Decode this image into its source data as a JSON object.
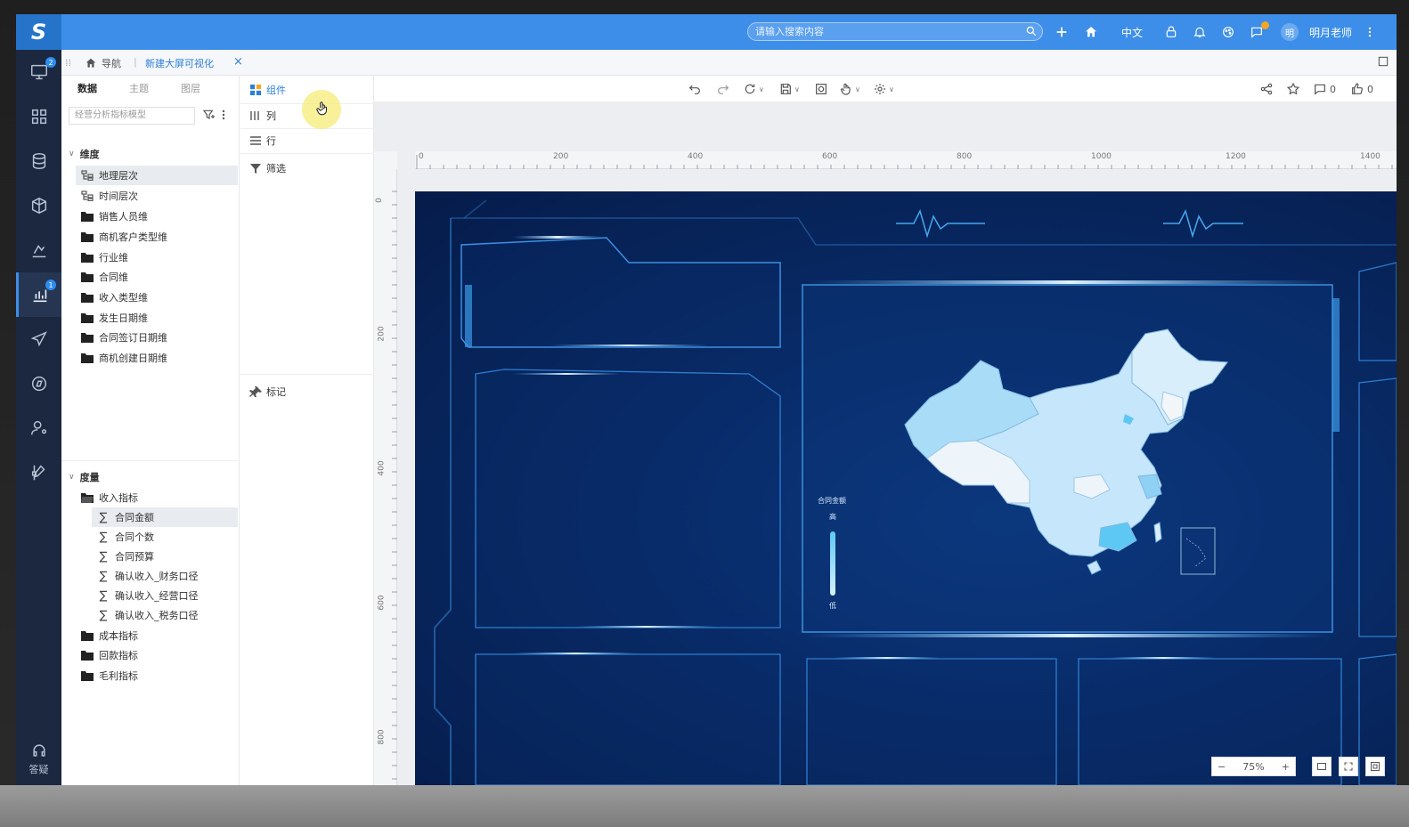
{
  "topbar": {
    "search_placeholder": "请输入搜索内容",
    "language": "中文",
    "avatar_text": "明",
    "user_name": "明月老师"
  },
  "rail": {
    "badges": [
      "2",
      "1"
    ],
    "help_label": "答疑"
  },
  "tabbar": {
    "home_label": "导航",
    "separator": "|",
    "active_tab": "新建大屏可视化",
    "close_symbol": "×"
  },
  "datapanel": {
    "tabs": [
      "数据",
      "主题",
      "图层"
    ],
    "model_select_value": "经营分析指标模型",
    "dimension_section": "维度",
    "dimensions": [
      "地理层次",
      "时间层次",
      "销售人员维",
      "商机客户类型维",
      "行业维",
      "合同维",
      "收入类型维",
      "发生日期维",
      "合同签订日期维",
      "商机创建日期维"
    ],
    "measure_section": "度量",
    "measure_folder": "收入指标",
    "measures": [
      "合同金额",
      "合同个数",
      "合同预算",
      "确认收入_财务口径",
      "确认收入_经营口径",
      "确认收入_税务口径"
    ],
    "other_folders": [
      "成本指标",
      "回款指标",
      "毛利指标"
    ]
  },
  "shelf": {
    "component": "组件",
    "columns": "列",
    "rows": "行",
    "filter": "筛选",
    "marks": "标记"
  },
  "toolbar": {
    "comment_count": "0",
    "like_count": "0"
  },
  "ruler": {
    "top_labels": [
      "0",
      "200",
      "400",
      "600",
      "800",
      "1000",
      "1200",
      "1400"
    ],
    "left_labels": [
      "0",
      "200",
      "400",
      "600",
      "800"
    ]
  },
  "map": {
    "legend_title": "合同金额",
    "legend_high": "高",
    "legend_low": "低"
  },
  "zoom": {
    "minus": "−",
    "value": "75%",
    "plus": "+"
  },
  "colors": {
    "topbar": "#3d8ee8",
    "rail": "#1b2840",
    "accent": "#2d7fd6",
    "screen_bg": "#082a66",
    "map_light": "#c6e6fb",
    "map_mid": "#8fd0f5"
  }
}
